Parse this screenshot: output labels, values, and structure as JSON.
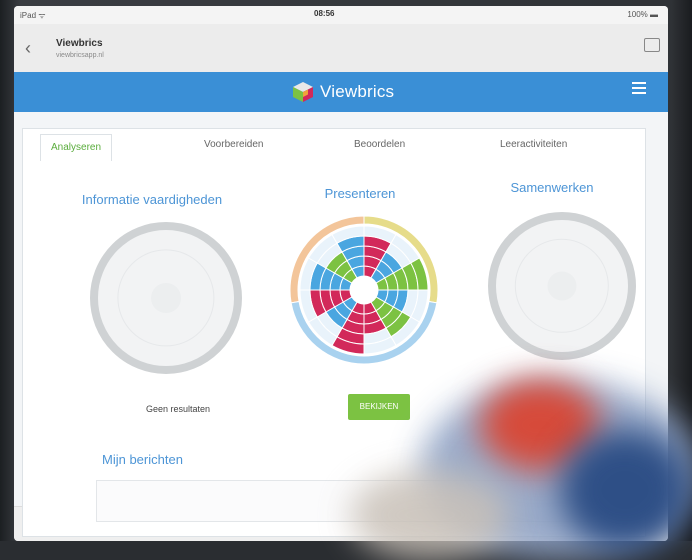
{
  "status_bar": {
    "carrier": "iPad ᯤ",
    "time": "08:56",
    "battery": "100% ▬"
  },
  "browser": {
    "site_title": "Viewbrics",
    "site_url": "viewbricsapp.nl",
    "back_icon": "chevron-left-icon",
    "tabs_icon": "tabs-icon"
  },
  "app": {
    "brand": "Viewbrics",
    "menu_icon": "hamburger-menu-icon",
    "accent": "#3a8fd6"
  },
  "tabs": [
    {
      "label": "Analyseren",
      "active": true
    },
    {
      "label": "Voorbereiden",
      "active": false
    },
    {
      "label": "Beoordelen",
      "active": false
    },
    {
      "label": "Leeractiviteiten",
      "active": false
    }
  ],
  "widgets": [
    {
      "title": "Informatie vaardigheden",
      "status": "Geen resultaten"
    },
    {
      "title": "Presenteren",
      "action": "BEKIJKEN"
    },
    {
      "title": "Samenwerken"
    }
  ],
  "messages": {
    "title": "Mijn berichten"
  },
  "colors": {
    "green": "#7cc242",
    "blue": "#4aa6e0",
    "crimson": "#d2295a",
    "ring_blue": "#a9d2ef",
    "ring_orange": "#f3c59a",
    "ring_yellow": "#e6dc8a"
  }
}
